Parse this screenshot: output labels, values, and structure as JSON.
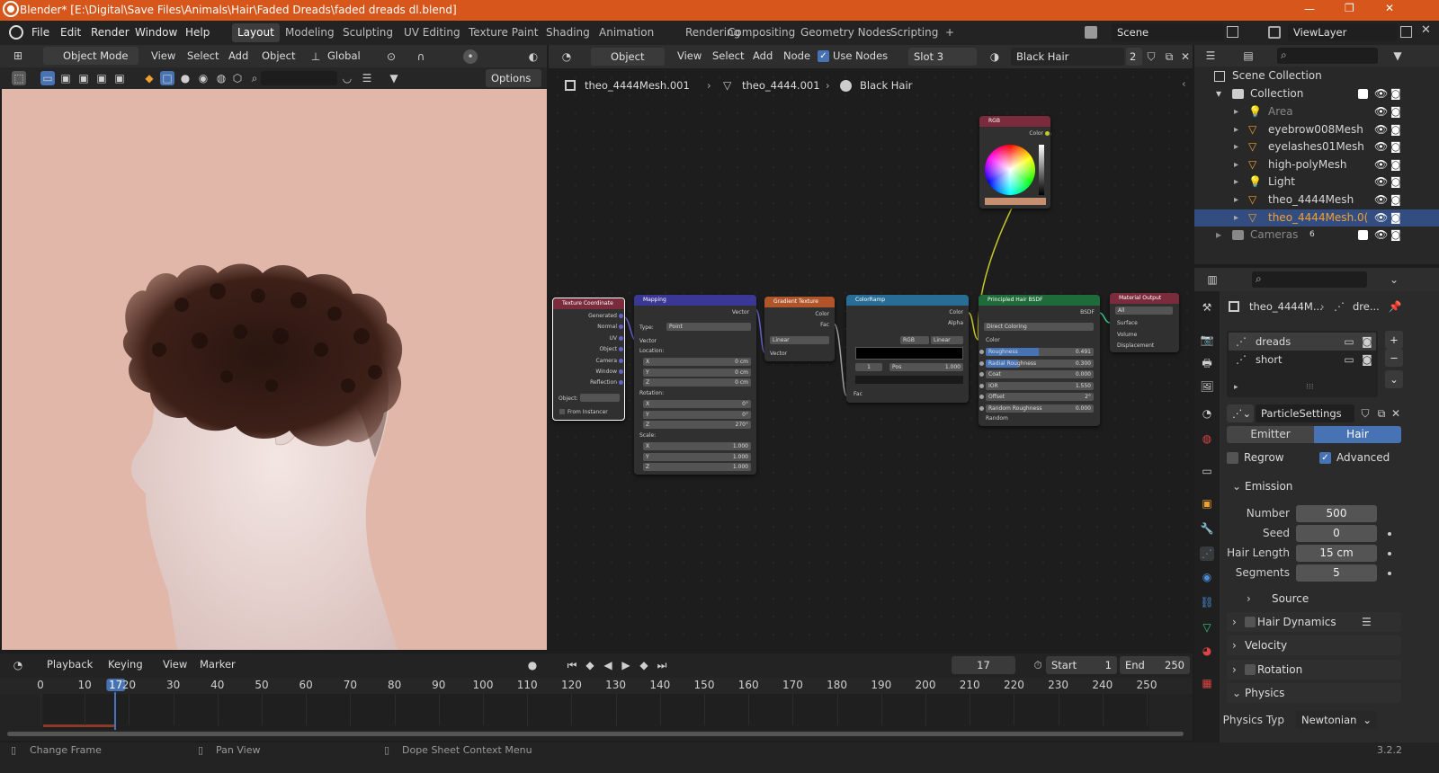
{
  "titlebar": {
    "title": "Blender* [E:\\Digital\\Save Files\\Animals\\Hair\\Faded Dreads\\faded dreads dl.blend]",
    "minimize": "—",
    "maximize": "❐",
    "close": "✕"
  },
  "menu": {
    "file": "File",
    "edit": "Edit",
    "render": "Render",
    "window": "Window",
    "help": "Help"
  },
  "workspaces": [
    "Layout",
    "Modeling",
    "Sculpting",
    "UV Editing",
    "Texture Paint",
    "Shading",
    "Animation",
    "Rendering",
    "Compositing",
    "Geometry Nodes",
    "Scripting",
    "+"
  ],
  "scene": {
    "name": "Scene",
    "viewlayer": "ViewLayer"
  },
  "viewport_header": {
    "mode": "Object Mode",
    "view": "View",
    "select": "Select",
    "add": "Add",
    "object": "Object",
    "transform": "Global",
    "options": "Options"
  },
  "node_header": {
    "type": "Object",
    "view": "View",
    "select": "Select",
    "add": "Add",
    "node": "Node",
    "use_nodes": "Use Nodes",
    "slot": "Slot 3",
    "material": "Black Hair",
    "users": "2"
  },
  "breadcrumb": {
    "mesh": "theo_4444Mesh.001",
    "object": "theo_4444.001",
    "material": "Black Hair"
  },
  "nodes": {
    "rgb": {
      "title": "RGB",
      "color": "Color"
    },
    "texcoord": {
      "title": "Texture Coordinate",
      "outputs": [
        "Generated",
        "Normal",
        "UV",
        "Object",
        "Camera",
        "Window",
        "Reflection"
      ],
      "object": "Object:",
      "instancer": "From Instancer"
    },
    "mapping": {
      "title": "Mapping",
      "vector": "Vector",
      "type_label": "Type:",
      "type": "Point",
      "vector_in": "Vector",
      "location": "Location:",
      "loc": [
        "0 cm",
        "0 cm",
        "0 cm"
      ],
      "rotation": "Rotation:",
      "rot": [
        "0°",
        "0°",
        "270°"
      ],
      "scale": "Scale:",
      "scl": [
        "1.000",
        "1.000",
        "1.000"
      ],
      "axes": [
        "X",
        "Y",
        "Z"
      ]
    },
    "gradient": {
      "title": "Gradient Texture",
      "color": "Color",
      "fac": "Fac",
      "type": "Linear",
      "vector": "Vector"
    },
    "ramp": {
      "title": "ColorRamp",
      "color": "Color",
      "alpha": "Alpha",
      "mode": "RGB",
      "interp": "Linear",
      "index": "1",
      "pos_label": "Pos",
      "pos": "1.000",
      "fac": "Fac"
    },
    "hair": {
      "title": "Principled Hair BSDF",
      "bsdf": "BSDF",
      "param": "Direct Coloring",
      "color": "Color",
      "rows": [
        {
          "label": "Roughness",
          "value": "0.491"
        },
        {
          "label": "Radial Roughness",
          "value": "0.300"
        },
        {
          "label": "Coat",
          "value": "0.000"
        },
        {
          "label": "IOR",
          "value": "1.550"
        },
        {
          "label": "Offset",
          "value": "2°"
        },
        {
          "label": "Random Roughness",
          "value": "0.000"
        }
      ],
      "random": "Random"
    },
    "output": {
      "title": "Material Output",
      "target": "All",
      "surface": "Surface",
      "volume": "Volume",
      "displacement": "Displacement"
    }
  },
  "outliner": {
    "root": "Scene Collection",
    "collection": "Collection",
    "items": [
      {
        "label": "Area",
        "type": "light",
        "dim": true
      },
      {
        "label": "eyebrow008Mesh",
        "type": "mesh"
      },
      {
        "label": "eyelashes01Mesh",
        "type": "mesh"
      },
      {
        "label": "high-polyMesh",
        "type": "mesh"
      },
      {
        "label": "Light",
        "type": "light"
      },
      {
        "label": "theo_4444Mesh",
        "type": "mesh"
      },
      {
        "label": "theo_4444Mesh.0(",
        "type": "mesh",
        "selected": true
      }
    ],
    "cameras": "Cameras",
    "cameras_count": "6"
  },
  "properties": {
    "crumb_obj": "theo_4444M...",
    "crumb_ps": "dre...",
    "systems": [
      "dreads",
      "short"
    ],
    "settings": "ParticleSettings",
    "tab_emitter": "Emitter",
    "tab_hair": "Hair",
    "regrow": "Regrow",
    "advanced": "Advanced",
    "emission": "Emission",
    "number_label": "Number",
    "number": "500",
    "seed_label": "Seed",
    "seed": "0",
    "length_label": "Hair Length",
    "length": "15 cm",
    "segments_label": "Segments",
    "segments": "5",
    "source": "Source",
    "dynamics": "Hair Dynamics",
    "velocity": "Velocity",
    "rotation": "Rotation",
    "physics": "Physics",
    "physics_type_label": "Physics Typ",
    "physics_type": "Newtonian"
  },
  "timeline": {
    "playback": "Playback",
    "keying": "Keying",
    "view": "View",
    "marker": "Marker",
    "current": "17",
    "start_label": "Start",
    "start": "1",
    "end_label": "End",
    "end": "250",
    "ticks": [
      "0",
      "10",
      "17",
      "20",
      "30",
      "40",
      "50",
      "60",
      "70",
      "80",
      "90",
      "100",
      "110",
      "120",
      "130",
      "140",
      "150",
      "160",
      "170",
      "180",
      "190",
      "200",
      "210",
      "220",
      "230",
      "240",
      "250"
    ]
  },
  "status": {
    "left": "Change Frame",
    "mid": "Pan View",
    "right": "Dope Sheet Context Menu",
    "version": "3.2.2"
  },
  "colors": {
    "accent": "#4772b3",
    "title": "#d6561b",
    "hair_node": "#1f6b3a",
    "ramp_node": "#276d95",
    "mapping_node": "#3b3794",
    "tex_node": "#7a2b3c"
  }
}
